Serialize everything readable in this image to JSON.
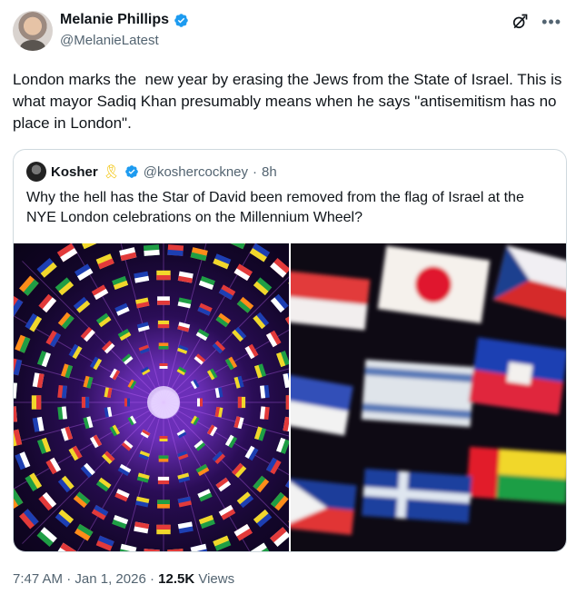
{
  "author": {
    "name": "Melanie Phillips",
    "handle": "@MelanieLatest"
  },
  "tweet": {
    "text": "London marks the  new year by erasing the Jews from the State of Israel. This is what mayor Sadiq Khan presumably means when he says \"antisemitism has no place in London\"."
  },
  "quote": {
    "name": "Kosher",
    "handle": "@koshercockney",
    "dot": "·",
    "time": "8h",
    "text": "Why the hell has the Star of David been removed from the flag of Israel at the NYE London celebrations on the Millennium Wheel?"
  },
  "footer": {
    "time": "7:47 AM",
    "date": "Jan 1, 2026",
    "dot": "·",
    "views_count": "12.5K",
    "views_label": "Views"
  },
  "colors": {
    "verified": "#1d9bf0",
    "ribbon": "#f2c200",
    "muted": "#536471"
  },
  "icons": [
    "verified-badge-icon",
    "grok-icon",
    "more-icon",
    "ribbon-icon"
  ]
}
